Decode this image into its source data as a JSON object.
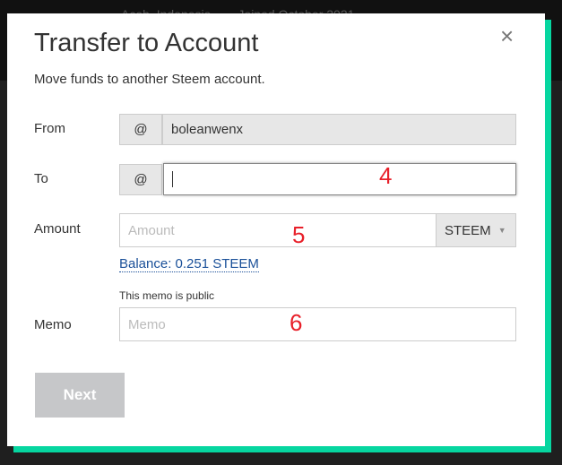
{
  "background": {
    "location": "Aceh, Indonesia",
    "joined": "Joined October 2021"
  },
  "modal": {
    "title": "Transfer to Account",
    "subtitle": "Move funds to another Steem account.",
    "close_icon": "×",
    "from": {
      "label": "From",
      "prefix": "@",
      "value": "boleanwenx"
    },
    "to": {
      "label": "To",
      "prefix": "@",
      "value": "",
      "annotation": "4"
    },
    "amount": {
      "label": "Amount",
      "placeholder": "Amount",
      "currency": "STEEM",
      "annotation": "5",
      "balance": "Balance: 0.251 STEEM"
    },
    "memo": {
      "label": "Memo",
      "note": "This memo is public",
      "placeholder": "Memo",
      "annotation": "6"
    },
    "next_label": "Next"
  },
  "colors": {
    "accent": "#06d6a0",
    "link": "#1a5099",
    "annotation": "#e8202a"
  }
}
